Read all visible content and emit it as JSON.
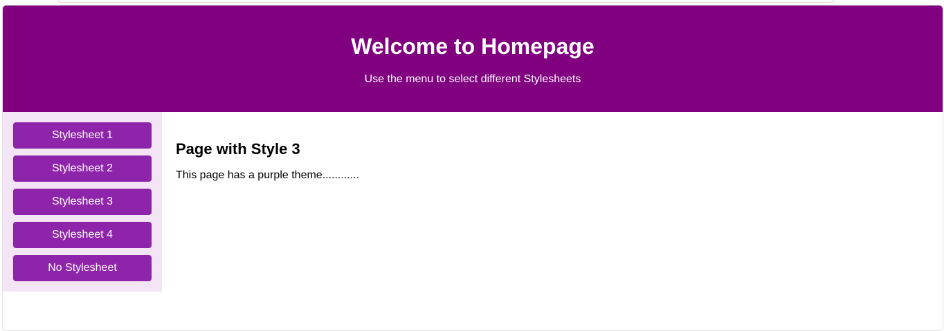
{
  "colors": {
    "header_bg": "#800080",
    "sidebar_bg": "#f3e5f5",
    "button_bg": "#8e24aa"
  },
  "header": {
    "title": "Welcome to Homepage",
    "subtitle": "Use the menu to select different Stylesheets"
  },
  "sidebar": {
    "items": [
      {
        "label": "Stylesheet 1"
      },
      {
        "label": "Stylesheet 2"
      },
      {
        "label": "Stylesheet 3"
      },
      {
        "label": "Stylesheet 4"
      },
      {
        "label": "No Stylesheet"
      }
    ]
  },
  "main": {
    "heading": "Page with Style 3",
    "text": "This page has a purple theme............"
  }
}
